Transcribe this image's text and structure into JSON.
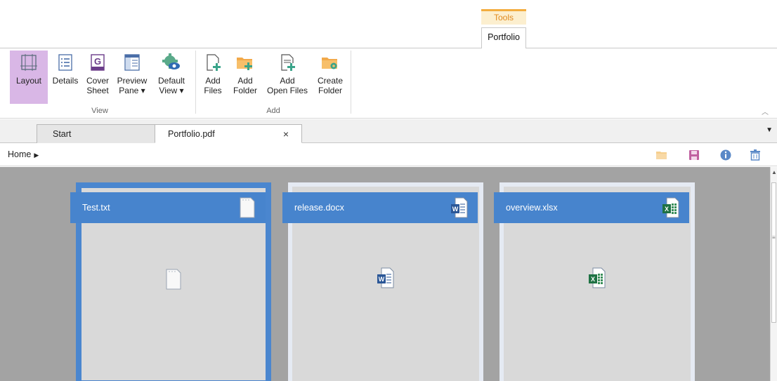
{
  "context_tabs": {
    "group": "Tools",
    "tab": "Portfolio"
  },
  "ribbon": {
    "view_group": "View",
    "add_group": "Add",
    "buttons": {
      "layout": "Layout",
      "details": "Details",
      "cover_sheet": "Cover\nSheet",
      "preview_pane": "Preview\nPane ▾",
      "default_view": "Default\nView ▾",
      "add_files": "Add\nFiles",
      "add_folder": "Add\nFolder",
      "add_open_files": "Add\nOpen Files",
      "create_folder": "Create\nFolder"
    }
  },
  "doc_tabs": [
    {
      "label": "Start"
    },
    {
      "label": "Portfolio.pdf",
      "close": "×"
    }
  ],
  "breadcrumb": {
    "label": "Home"
  },
  "files": [
    {
      "name": "Test.txt",
      "type": "txt-icon"
    },
    {
      "name": "release.docx",
      "type": "word-icon"
    },
    {
      "name": "overview.xlsx",
      "type": "excel-icon"
    }
  ],
  "colors": {
    "accent_selected": "#4a86cf",
    "card_header": "#4784cd",
    "layout_selected_bg": "#d9b7e6",
    "tools_orange": "#f3ad3e",
    "content_bg": "#a3a3a3"
  }
}
